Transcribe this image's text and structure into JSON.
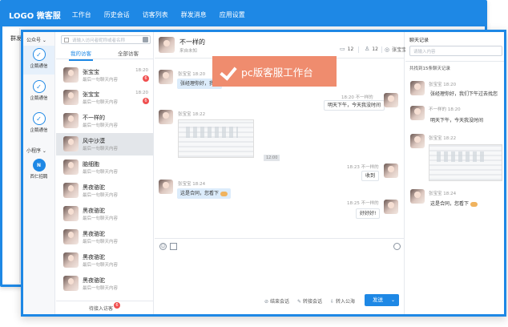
{
  "back_window": {
    "logo": "LOGO 微客服",
    "nav": [
      "工作台",
      "历史会话",
      "访客列表",
      "群发消息",
      "应用设置"
    ],
    "sub_label": "群发"
  },
  "sidebar": {
    "section_public": "公众号",
    "section_mini": "小程序",
    "items": [
      {
        "label": "企鹅通信",
        "icon": "wechat-icon"
      },
      {
        "label": "企鹅通信",
        "icon": "wechat-icon"
      },
      {
        "label": "企鹅通信",
        "icon": "wechat-icon"
      },
      {
        "label": "西仁招聘",
        "icon": "miniprogram-icon"
      }
    ]
  },
  "visitors": {
    "search_placeholder": "请输入访问者昵称或者名称",
    "tabs": [
      "我的访客",
      "全部访客"
    ],
    "list": [
      {
        "name": "张宝宝",
        "last": "最后一句聊天内容",
        "time": "18:20",
        "badge": "6"
      },
      {
        "name": "张宝宝",
        "last": "最后一句聊天内容",
        "time": "18:20",
        "badge": "6"
      },
      {
        "name": "不一样的",
        "last": "最后一句聊天内容",
        "time": "",
        "badge": ""
      },
      {
        "name": "风中沙漠",
        "last": "最后一句聊天内容",
        "time": "",
        "badge": ""
      },
      {
        "name": "脑细胞",
        "last": "最后一句聊天内容",
        "time": "",
        "badge": ""
      },
      {
        "name": "黑夜骆驼",
        "last": "最后一句聊天内容",
        "time": "",
        "badge": ""
      },
      {
        "name": "黑夜骆驼",
        "last": "最后一句聊天内容",
        "time": "",
        "badge": ""
      },
      {
        "name": "黑夜骆驼",
        "last": "最后一句聊天内容",
        "time": "",
        "badge": ""
      },
      {
        "name": "黑夜骆驼",
        "last": "最后一句聊天内容",
        "time": "",
        "badge": ""
      },
      {
        "name": "黑夜骆驼",
        "last": "最后一句聊天内容",
        "time": "",
        "badge": ""
      }
    ],
    "pending_label": "待接入访客",
    "pending_count": "6"
  },
  "chat": {
    "title": "不一样的",
    "subtitle": "来自未知",
    "stats": {
      "messages": "12",
      "visitors": "12",
      "agent": "张宝宝"
    },
    "messages": [
      {
        "dir": "in",
        "sender": "张宝宝",
        "time": "18:20",
        "text": "张经理你好，我们"
      },
      {
        "dir": "out",
        "sender": "不一样的",
        "time": "18:20",
        "text": "明天下午，今天我没时间"
      },
      {
        "dir": "in",
        "sender": "张宝宝",
        "time": "18:22",
        "text": ""
      },
      {
        "dir": "out",
        "sender": "不一样的",
        "time": "18:23",
        "text": "收到"
      },
      {
        "dir": "in",
        "sender": "张宝宝",
        "time": "18:24",
        "text": "这是合同，您看下"
      },
      {
        "dir": "out",
        "sender": "不一样的",
        "time": "18:25",
        "text": "好好好!"
      }
    ],
    "time_divider": "12:00",
    "actions": {
      "end": "结束会话",
      "transfer": "转接会话",
      "pool": "转入公海"
    },
    "send": "发送"
  },
  "history": {
    "title": "聊天记录",
    "search_placeholder": "请输入内容",
    "count_text": "共找到15条聊天记录",
    "messages": [
      {
        "sender": "张宝宝",
        "time": "18:20",
        "text": "张经理你好，我们下午过去找您"
      },
      {
        "sender": "不一样的",
        "time": "18:20",
        "text": "明天下午，今天我没时间"
      },
      {
        "sender": "张宝宝",
        "time": "18:22",
        "text": ""
      },
      {
        "sender": "张宝宝",
        "time": "18:24",
        "text": "这是合同，您看下"
      }
    ]
  },
  "banner": {
    "text": "pc版客服工作台"
  },
  "colors": {
    "primary": "#1e88e5",
    "banner": "#ef8c6e",
    "badge": "#f05050"
  }
}
